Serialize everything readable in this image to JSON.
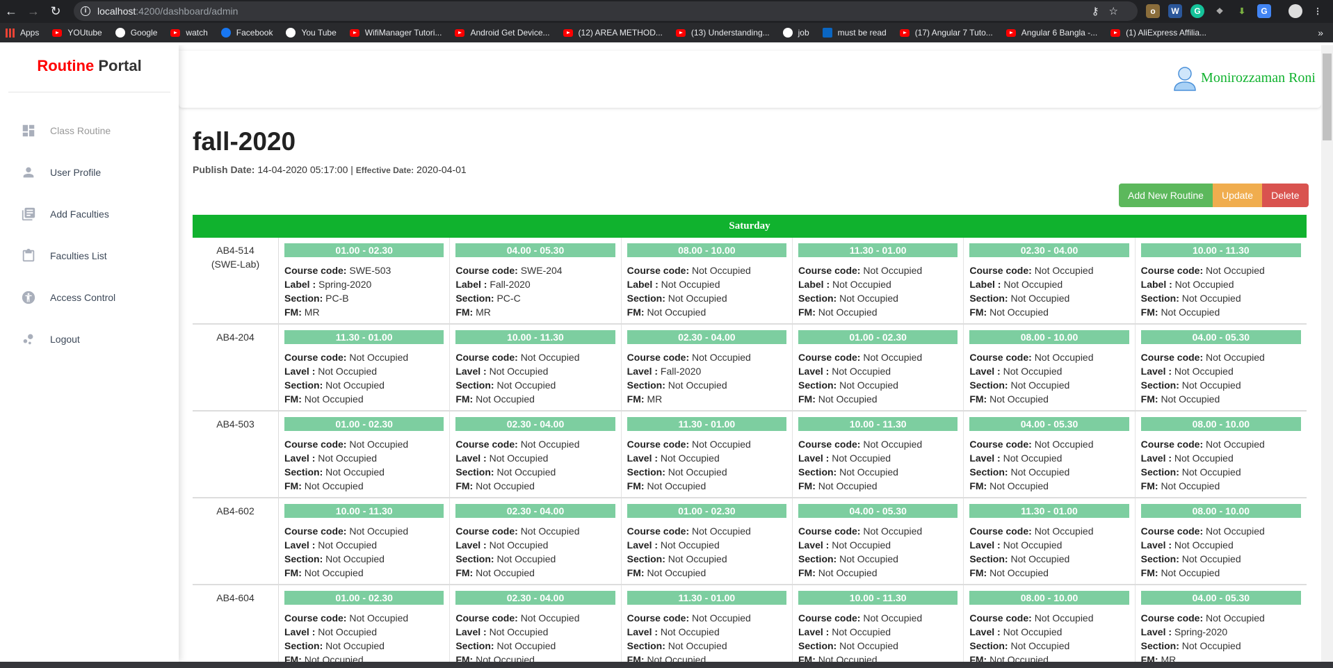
{
  "browser": {
    "url_host": "localhost",
    "url_path": ":4200/dashboard/admin",
    "bookmarks": [
      {
        "label": "Apps",
        "icon": "apps"
      },
      {
        "label": "YOUtube",
        "icon": "yt"
      },
      {
        "label": "Google",
        "icon": "g"
      },
      {
        "label": "watch",
        "icon": "yt"
      },
      {
        "label": "Facebook",
        "icon": "f"
      },
      {
        "label": "You Tube",
        "icon": "g"
      },
      {
        "label": "WifiManager Tutori...",
        "icon": "yt"
      },
      {
        "label": "Android Get Device...",
        "icon": "yt"
      },
      {
        "label": "(12) AREA METHOD...",
        "icon": "yt"
      },
      {
        "label": "(13) Understanding...",
        "icon": "yt"
      },
      {
        "label": "job",
        "icon": "g"
      },
      {
        "label": "must be read",
        "icon": "in"
      },
      {
        "label": "(17) Angular 7 Tuto...",
        "icon": "yt"
      },
      {
        "label": "Angular 6 Bangla -...",
        "icon": "yt"
      },
      {
        "label": "(1) AliExpress Affilia...",
        "icon": "yt"
      }
    ],
    "more": "»"
  },
  "sidebar": {
    "brand_red": "Routine",
    "brand_dark": "Portal",
    "items": [
      {
        "label": "Class Routine"
      },
      {
        "label": "User Profile"
      },
      {
        "label": "Add Faculties"
      },
      {
        "label": "Faculties List"
      },
      {
        "label": "Access Control"
      },
      {
        "label": "Logout"
      }
    ]
  },
  "header": {
    "user_name": "Monirozzaman Roni"
  },
  "routine": {
    "title": "fall-2020",
    "publish_label": "Publish Date:",
    "publish_value": "14-04-2020 05:17:00",
    "sep": "|",
    "effective_label": "Effective Date:",
    "effective_value": "2020-04-01"
  },
  "actions": {
    "add": "Add New Routine",
    "update": "Update",
    "delete": "Delete"
  },
  "labels": {
    "course": "Course code:",
    "section": "Section:",
    "fm": "FM:"
  },
  "day": "Saturday",
  "rows": [
    {
      "room": "AB4-514\n(SWE-Lab)",
      "level_label": "Label :",
      "cells": [
        {
          "time": "01.00 - 02.30",
          "course": "SWE-503",
          "level": "Spring-2020",
          "section": "PC-B",
          "fm": "MR"
        },
        {
          "time": "04.00 - 05.30",
          "course": "SWE-204",
          "level": "Fall-2020",
          "section": "PC-C",
          "fm": "MR"
        },
        {
          "time": "08.00 - 10.00",
          "course": "Not Occupied",
          "level": "Not Occupied",
          "section": "Not Occupied",
          "fm": "Not Occupied"
        },
        {
          "time": "11.30 - 01.00",
          "course": "Not Occupied",
          "level": "Not Occupied",
          "section": "Not Occupied",
          "fm": "Not Occupied"
        },
        {
          "time": "02.30 - 04.00",
          "course": "Not Occupied",
          "level": "Not Occupied",
          "section": "Not Occupied",
          "fm": "Not Occupied"
        },
        {
          "time": "10.00 - 11.30",
          "course": "Not Occupied",
          "level": "Not Occupied",
          "section": "Not Occupied",
          "fm": "Not Occupied"
        }
      ]
    },
    {
      "room": "AB4-204",
      "level_label": "Lavel :",
      "cells": [
        {
          "time": "11.30 - 01.00",
          "course": "Not Occupied",
          "level": "Not Occupied",
          "section": "Not Occupied",
          "fm": "Not Occupied"
        },
        {
          "time": "10.00 - 11.30",
          "course": "Not Occupied",
          "level": "Not Occupied",
          "section": "Not Occupied",
          "fm": "Not Occupied"
        },
        {
          "time": "02.30 - 04.00",
          "course": "Not Occupied",
          "level": "Fall-2020",
          "section": "Not Occupied",
          "fm": "MR"
        },
        {
          "time": "01.00 - 02.30",
          "course": "Not Occupied",
          "level": "Not Occupied",
          "section": "Not Occupied",
          "fm": "Not Occupied"
        },
        {
          "time": "08.00 - 10.00",
          "course": "Not Occupied",
          "level": "Not Occupied",
          "section": "Not Occupied",
          "fm": "Not Occupied"
        },
        {
          "time": "04.00 - 05.30",
          "course": "Not Occupied",
          "level": "Not Occupied",
          "section": "Not Occupied",
          "fm": "Not Occupied"
        }
      ]
    },
    {
      "room": "AB4-503",
      "level_label": "Lavel :",
      "cells": [
        {
          "time": "01.00 - 02.30",
          "course": "Not Occupied",
          "level": "Not Occupied",
          "section": "Not Occupied",
          "fm": "Not Occupied"
        },
        {
          "time": "02.30 - 04.00",
          "course": "Not Occupied",
          "level": "Not Occupied",
          "section": "Not Occupied",
          "fm": "Not Occupied"
        },
        {
          "time": "11.30 - 01.00",
          "course": "Not Occupied",
          "level": "Not Occupied",
          "section": "Not Occupied",
          "fm": "Not Occupied"
        },
        {
          "time": "10.00 - 11.30",
          "course": "Not Occupied",
          "level": "Not Occupied",
          "section": "Not Occupied",
          "fm": "Not Occupied"
        },
        {
          "time": "04.00 - 05.30",
          "course": "Not Occupied",
          "level": "Not Occupied",
          "section": "Not Occupied",
          "fm": "Not Occupied"
        },
        {
          "time": "08.00 - 10.00",
          "course": "Not Occupied",
          "level": "Not Occupied",
          "section": "Not Occupied",
          "fm": "Not Occupied"
        }
      ]
    },
    {
      "room": "AB4-602",
      "level_label": "Lavel :",
      "cells": [
        {
          "time": "10.00 - 11.30",
          "course": "Not Occupied",
          "level": "Not Occupied",
          "section": "Not Occupied",
          "fm": "Not Occupied"
        },
        {
          "time": "02.30 - 04.00",
          "course": "Not Occupied",
          "level": "Not Occupied",
          "section": "Not Occupied",
          "fm": "Not Occupied"
        },
        {
          "time": "01.00 - 02.30",
          "course": "Not Occupied",
          "level": "Not Occupied",
          "section": "Not Occupied",
          "fm": "Not Occupied"
        },
        {
          "time": "04.00 - 05.30",
          "course": "Not Occupied",
          "level": "Not Occupied",
          "section": "Not Occupied",
          "fm": "Not Occupied"
        },
        {
          "time": "11.30 - 01.00",
          "course": "Not Occupied",
          "level": "Not Occupied",
          "section": "Not Occupied",
          "fm": "Not Occupied"
        },
        {
          "time": "08.00 - 10.00",
          "course": "Not Occupied",
          "level": "Not Occupied",
          "section": "Not Occupied",
          "fm": "Not Occupied"
        }
      ]
    },
    {
      "room": "AB4-604",
      "level_label": "Lavel :",
      "cells": [
        {
          "time": "01.00 - 02.30",
          "course": "Not Occupied",
          "level": "Not Occupied",
          "section": "Not Occupied",
          "fm": "Not Occupied"
        },
        {
          "time": "02.30 - 04.00",
          "course": "Not Occupied",
          "level": "Not Occupied",
          "section": "Not Occupied",
          "fm": "Not Occupied"
        },
        {
          "time": "11.30 - 01.00",
          "course": "Not Occupied",
          "level": "Not Occupied",
          "section": "Not Occupied",
          "fm": "Not Occupied"
        },
        {
          "time": "10.00 - 11.30",
          "course": "Not Occupied",
          "level": "Not Occupied",
          "section": "Not Occupied",
          "fm": "Not Occupied"
        },
        {
          "time": "08.00 - 10.00",
          "course": "Not Occupied",
          "level": "Not Occupied",
          "section": "Not Occupied",
          "fm": "Not Occupied"
        },
        {
          "time": "04.00 - 05.30",
          "course": "Not Occupied",
          "level": "Spring-2020",
          "section": "Not Occupied",
          "fm": "MR"
        }
      ]
    }
  ]
}
